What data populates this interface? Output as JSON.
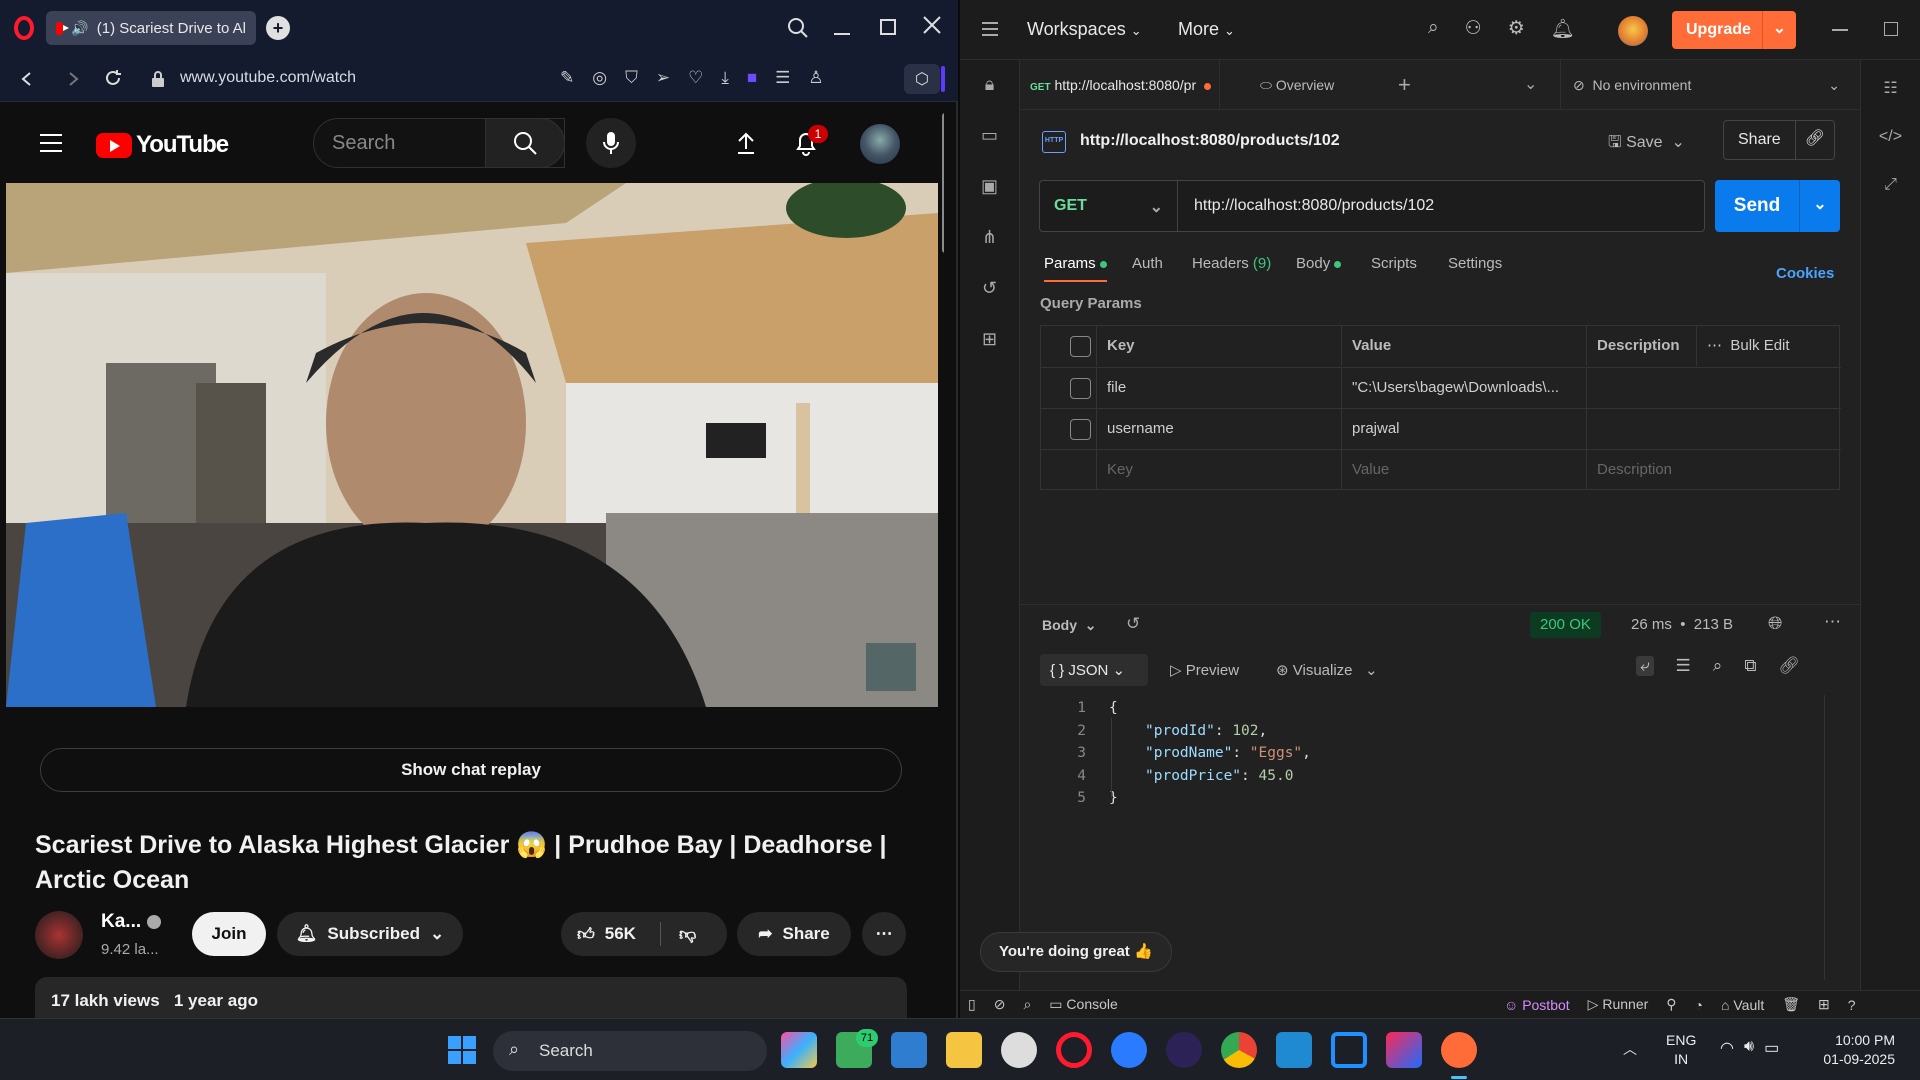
{
  "opera": {
    "tab_title": "(1) Scariest Drive to Al",
    "url": "www.youtube.com/watch"
  },
  "youtube": {
    "logo_text": "YouTube",
    "search_placeholder": "Search",
    "notification_count": "1",
    "chat_replay_label": "Show chat replay",
    "video_title": "Scariest Drive to Alaska Highest Glacier 😱 | Prudhoe Bay | Deadhorse | Arctic Ocean",
    "channel_name": "Ka...",
    "subscribers": "9.42 la...",
    "join_label": "Join",
    "subscribed_label": "Subscribed",
    "likes": "56K",
    "share_label": "Share",
    "views": "17 lakh views",
    "age": "1 year ago"
  },
  "postman": {
    "workspaces_label": "Workspaces",
    "more_label": "More",
    "upgrade_label": "Upgrade",
    "tab_method": "GET",
    "tab_url": "http://localhost:8080/pr",
    "overview_tab": "Overview",
    "environment": "No environment",
    "request_title": "http://localhost:8080/products/102",
    "save_label": "Save",
    "share_label": "Share",
    "method": "GET",
    "url": "http://localhost:8080/products/102",
    "send_label": "Send",
    "req_tabs": [
      "Params",
      "Auth",
      "Headers",
      "Body",
      "Scripts",
      "Settings"
    ],
    "headers_count": "(9)",
    "cookies_label": "Cookies",
    "query_params_label": "Query Params",
    "table": {
      "headers": [
        "Key",
        "Value",
        "Description",
        "Bulk Edit"
      ],
      "rows": [
        {
          "key": "file",
          "value": "\"C:\\Users\\bagew\\Downloads\\...",
          "description": ""
        },
        {
          "key": "username",
          "value": "prajwal",
          "description": ""
        }
      ],
      "placeholders": {
        "key": "Key",
        "value": "Value",
        "description": "Description"
      }
    },
    "response": {
      "body_label": "Body",
      "status": "200 OK",
      "time": "26 ms",
      "size": "213 B",
      "format": "JSON",
      "preview_label": "Preview",
      "visualize_label": "Visualize",
      "line_numbers": [
        "1",
        "2",
        "3",
        "4",
        "5"
      ],
      "json_lines": {
        "l1": "{",
        "l2_key": "\"prodId\"",
        "l2_val": "102",
        "l3_key": "\"prodName\"",
        "l3_val": "\"Eggs\"",
        "l4_key": "\"prodPrice\"",
        "l4_val": "45.0",
        "l5": "}"
      }
    },
    "toast": "You're doing great 👍",
    "statusbar": {
      "console": "Console",
      "postbot": "Postbot",
      "runner": "Runner",
      "vault": "Vault"
    }
  },
  "taskbar": {
    "search_label": "Search",
    "badge": "71",
    "lang_line1": "ENG",
    "lang_line2": "IN",
    "time": "10:00 PM",
    "date": "01-09-2025"
  }
}
